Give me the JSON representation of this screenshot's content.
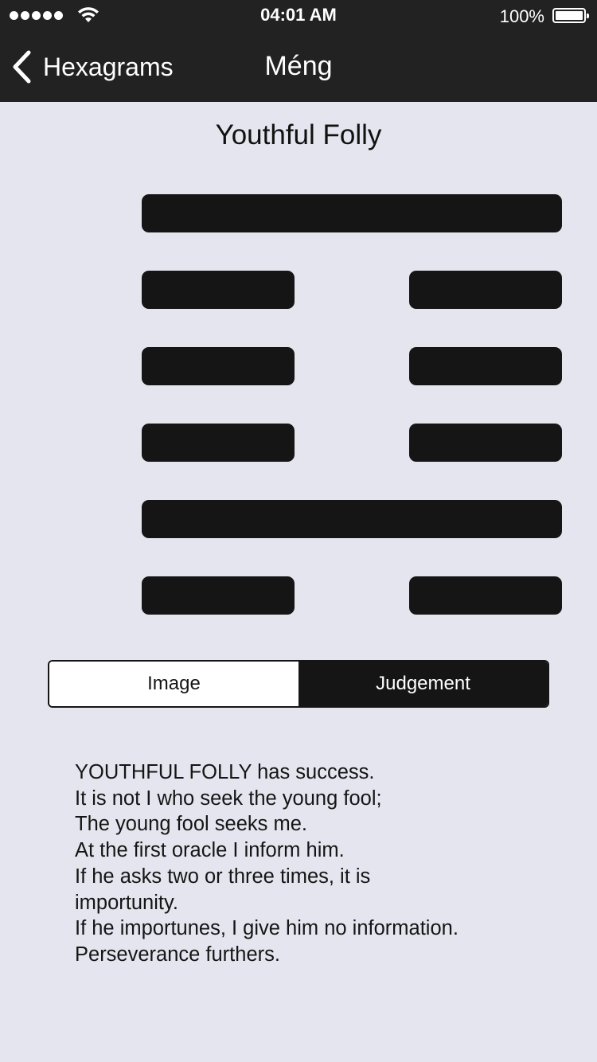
{
  "status_bar": {
    "time": "04:01 AM",
    "battery": "100%",
    "signal_icon": "signal-dots-icon",
    "wifi_icon": "wifi-icon",
    "battery_icon": "battery-icon"
  },
  "nav": {
    "back_label": "Hexagrams",
    "back_icon": "chevron-left-icon",
    "title": "Méng"
  },
  "hexagram": {
    "name": "Youthful Folly",
    "lines_top_to_bottom": [
      "yang",
      "yin",
      "yin",
      "yin",
      "yang",
      "yin"
    ]
  },
  "segmented": {
    "options": [
      "Image",
      "Judgement"
    ],
    "selected": "Judgement"
  },
  "judgement_text": [
    "YOUTHFUL FOLLY has success.",
    "It is not I who seek the young fool;",
    "The young fool seeks me.",
    "At the first oracle I inform him.",
    "If he asks two or three times, it is",
    "importunity.",
    "If he importunes, I give him no information.",
    "Perseverance furthers."
  ],
  "colors": {
    "bar_background": "#222222",
    "page_background": "#e5e5ef",
    "line_color": "#151515"
  }
}
